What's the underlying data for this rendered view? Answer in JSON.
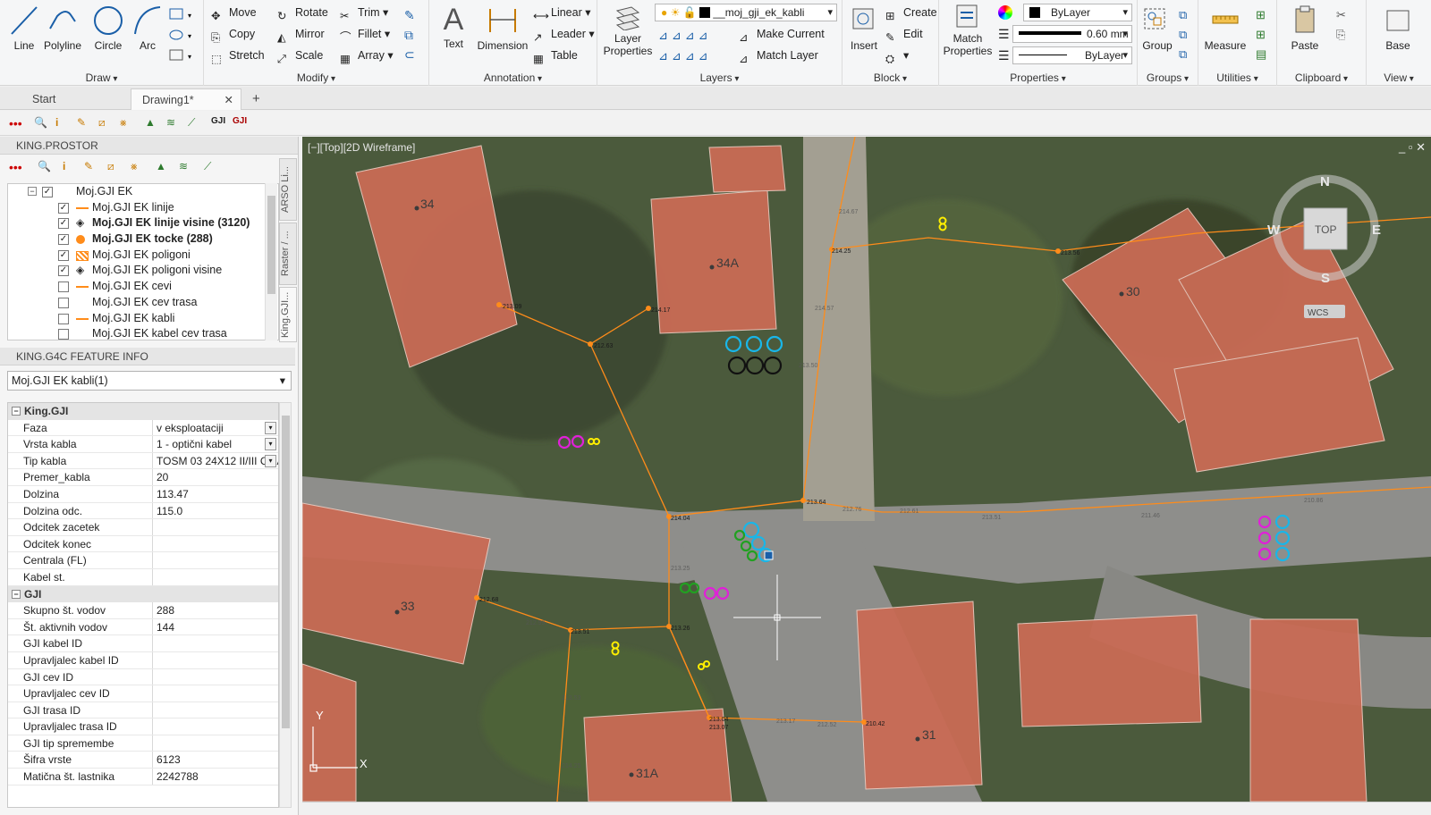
{
  "ribbon": {
    "draw": {
      "title": "Draw",
      "line": "Line",
      "polyline": "Polyline",
      "circle": "Circle",
      "arc": "Arc"
    },
    "modify": {
      "title": "Modify",
      "move": "Move",
      "rotate": "Rotate",
      "trim": "Trim",
      "copy": "Copy",
      "mirror": "Mirror",
      "fillet": "Fillet",
      "stretch": "Stretch",
      "scale": "Scale",
      "array": "Array"
    },
    "annotation": {
      "title": "Annotation",
      "text": "Text",
      "dimension": "Dimension",
      "linear": "Linear",
      "leader": "Leader",
      "table": "Table"
    },
    "layers": {
      "title": "Layers",
      "layer_properties_1": "Layer",
      "layer_properties_2": "Properties",
      "current_layer": "__moj_gji_ek_kabli",
      "make_current": "Make Current",
      "match_layer": "Match Layer"
    },
    "block": {
      "title": "Block",
      "insert": "Insert",
      "create": "Create",
      "edit": "Edit"
    },
    "properties": {
      "title": "Properties",
      "match_1": "Match",
      "match_2": "Properties",
      "color": "ByLayer",
      "lineweight": "0.60 mm",
      "linetype": "ByLayer"
    },
    "groups": {
      "title": "Groups",
      "group": "Group"
    },
    "utilities": {
      "title": "Utilities",
      "measure": "Measure"
    },
    "clipboard": {
      "title": "Clipboard",
      "paste": "Paste"
    },
    "view": {
      "title": "View",
      "base": "Base"
    }
  },
  "tabs": {
    "start": "Start",
    "drawing": "Drawing1*",
    "close": "✕",
    "add": "+"
  },
  "palette_prostor": {
    "title": "KING.PROSTOR",
    "root": "Moj.GJI EK",
    "layers": [
      {
        "label": "Moj.GJI EK linije",
        "checked": true,
        "bold": false,
        "icon": "line-icon"
      },
      {
        "label": "Moj.GJI EK linije visine (3120)",
        "checked": true,
        "bold": true,
        "icon": "diamond-icon"
      },
      {
        "label": "Moj.GJI EK tocke (288)",
        "checked": true,
        "bold": true,
        "icon": "dot-icon"
      },
      {
        "label": "Moj.GJI EK poligoni",
        "checked": true,
        "bold": false,
        "icon": "hatch-icon"
      },
      {
        "label": "Moj.GJI EK poligoni visine",
        "checked": true,
        "bold": false,
        "icon": "diamond-icon"
      },
      {
        "label": "Moj.GJI EK cevi",
        "checked": false,
        "bold": false,
        "icon": "line-icon"
      },
      {
        "label": "Moj.GJI EK cev trasa",
        "checked": false,
        "bold": false,
        "icon": "none"
      },
      {
        "label": "Moj.GJI EK kabli",
        "checked": false,
        "bold": false,
        "icon": "line-icon"
      },
      {
        "label": "Moj.GJI EK kabel cev trasa",
        "checked": false,
        "bold": false,
        "icon": "none"
      }
    ],
    "side_tabs": [
      "ARSO Li...",
      "Raster / ...",
      "King.GJI..."
    ]
  },
  "palette_feature": {
    "title": "KING.G4C FEATURE INFO",
    "selected": "Moj.GJI EK kabli(1)",
    "categories": [
      {
        "name": "King.GJI",
        "rows": [
          {
            "key": "Faza",
            "value": "v eksploataciji",
            "dropdown": true
          },
          {
            "key": "Vrsta kabla",
            "value": "1 - optični kabel",
            "dropdown": true
          },
          {
            "key": "Tip kabla",
            "value": "TOSM 03 24X12 II/III CMAN",
            "dropdown": true
          },
          {
            "key": "Premer_kabla",
            "value": "20",
            "dropdown": false
          },
          {
            "key": "Dolzina",
            "value": "113.47",
            "dropdown": false
          },
          {
            "key": "Dolzina odc.",
            "value": "115.0",
            "dropdown": false
          },
          {
            "key": "Odcitek zacetek",
            "value": "",
            "dropdown": false
          },
          {
            "key": "Odcitek konec",
            "value": "",
            "dropdown": false
          },
          {
            "key": "Centrala (FL)",
            "value": "",
            "dropdown": false
          },
          {
            "key": "Kabel st.",
            "value": "",
            "dropdown": false
          }
        ]
      },
      {
        "name": "GJI",
        "rows": [
          {
            "key": "Skupno št. vodov",
            "value": "288",
            "dropdown": false
          },
          {
            "key": "Št. aktivnih vodov",
            "value": "144",
            "dropdown": false
          },
          {
            "key": "GJI kabel ID",
            "value": "",
            "dropdown": false
          },
          {
            "key": "Upravljalec kabel ID",
            "value": "",
            "dropdown": false
          },
          {
            "key": "GJI cev ID",
            "value": "",
            "dropdown": false
          },
          {
            "key": "Upravljalec cev ID",
            "value": "",
            "dropdown": false
          },
          {
            "key": "GJI trasa ID",
            "value": "",
            "dropdown": false
          },
          {
            "key": "Upravljalec trasa ID",
            "value": "",
            "dropdown": false
          },
          {
            "key": "GJI tip spremembe",
            "value": "",
            "dropdown": false
          },
          {
            "key": "Šifra vrste",
            "value": "6123",
            "dropdown": false
          },
          {
            "key": "Matična št. lastnika",
            "value": "2242788",
            "dropdown": false
          }
        ]
      }
    ]
  },
  "viewport": {
    "label": "[−][Top][2D Wireframe]",
    "controls": "_ ▫ ✕",
    "viewcube": {
      "n": "N",
      "s": "S",
      "e": "E",
      "w": "W",
      "top": "TOP",
      "wcs": "WCS"
    },
    "ucs": {
      "x": "X",
      "y": "Y"
    },
    "house_numbers": [
      "34",
      "34A",
      "30",
      "33",
      "31",
      "31A"
    ],
    "elevations": [
      "213.09",
      "214.17",
      "212.63",
      "214.25",
      "213.56",
      "214.67",
      "214.57",
      "213.50",
      "214.04",
      "213.64",
      "212.76",
      "212.61",
      "211.46",
      "210.86",
      "212.68",
      "213.51",
      "213.26",
      "213.04",
      "213.07",
      "210.42",
      "213.25",
      "213.53",
      "214.25",
      "212.99",
      "213.17",
      "212.52",
      "213.51"
    ]
  },
  "colors": {
    "cable": "#ff8c1a",
    "cyan": "#19b6e8",
    "magenta": "#e020d8",
    "green": "#22a022",
    "yellow": "#ffee00",
    "roof": "#c96b55"
  }
}
